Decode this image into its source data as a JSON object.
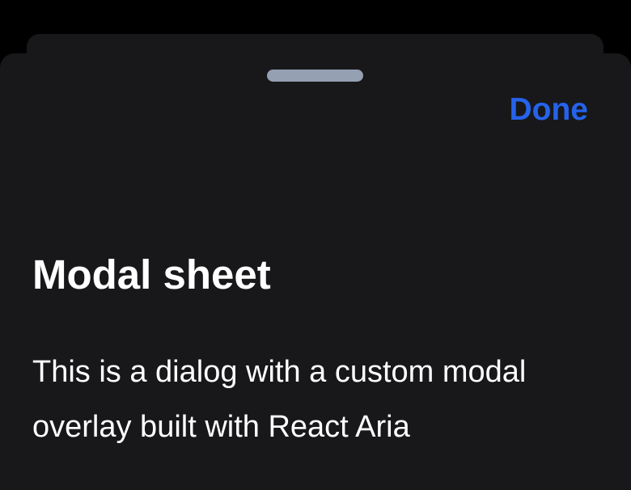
{
  "sheet": {
    "done_label": "Done",
    "title": "Modal sheet",
    "body": "This is a dialog with a custom modal overlay built with React Aria"
  },
  "colors": {
    "background": "#000000",
    "sheet": "#18181b",
    "handle": "#95a0b2",
    "accent": "#2563eb",
    "text": "#ffffff"
  }
}
